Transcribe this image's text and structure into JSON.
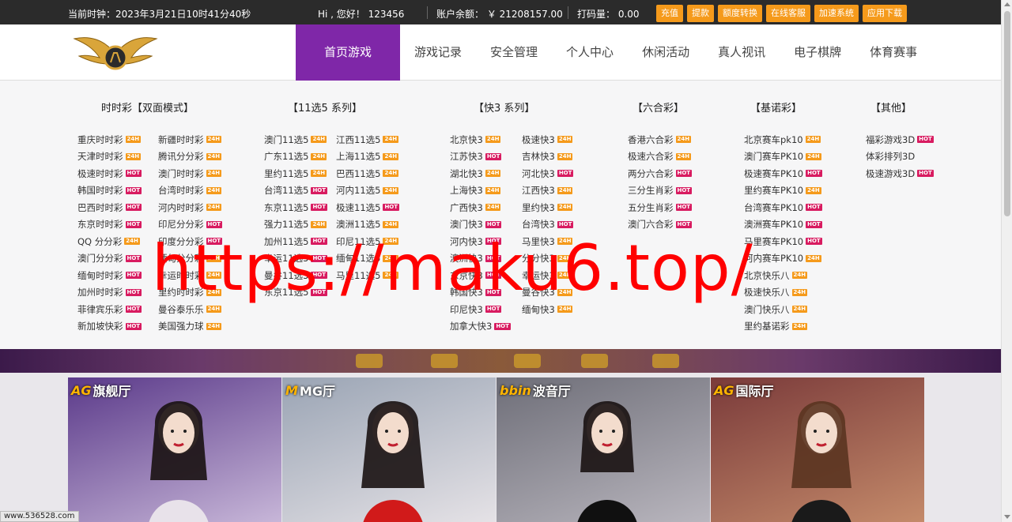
{
  "topbar": {
    "clock": "当前时钟：2023年3月21日10时41分40秒",
    "greeting": "Hi , 您好！ 123456",
    "balance": "账户余额：  ￥ 21208157.00",
    "bet_amount": "打码量：  0.00",
    "buttons": [
      "充值",
      "提款",
      "额度转换",
      "在线客服",
      "加速系统",
      "应用下载"
    ]
  },
  "nav": {
    "items": [
      "首页游戏",
      "游戏记录",
      "安全管理",
      "个人中心",
      "休闲活动",
      "真人视讯",
      "电子棋牌",
      "体育赛事"
    ],
    "active_index": 0
  },
  "colors": {
    "active_nav": "#7f27a8",
    "button": "#f59a1b",
    "hot_tag": "#d81b60",
    "tag_24h": "#f59a1b",
    "watermark": "#ff0000"
  },
  "tags": {
    "hot": "HOT",
    "h24": "24H"
  },
  "dropdown": {
    "columns": [
      {
        "title": "时时彩【双面模式】",
        "rows": [
          [
            [
              "重庆时时彩",
              "h24"
            ],
            [
              "新疆时时彩",
              "h24"
            ]
          ],
          [
            [
              "天津时时彩",
              "h24"
            ],
            [
              "腾讯分分彩",
              "h24"
            ]
          ],
          [
            [
              "极速时时彩",
              "hot"
            ],
            [
              "澳门时时彩",
              "h24"
            ]
          ],
          [
            [
              "韩国时时彩",
              "hot"
            ],
            [
              "台湾时时彩",
              "h24"
            ]
          ],
          [
            [
              "巴西时时彩",
              "hot"
            ],
            [
              "河内时时彩",
              "h24"
            ]
          ],
          [
            [
              "东京时时彩",
              "hot"
            ],
            [
              "印尼分分彩",
              "hot"
            ]
          ],
          [
            [
              "QQ 分分彩",
              "h24"
            ],
            [
              "印度分分彩",
              "hot"
            ]
          ],
          [
            [
              "澳门分分彩",
              "hot"
            ],
            [
              "缅甸分分彩",
              "h24"
            ]
          ],
          [
            [
              "缅甸时时彩",
              "hot"
            ],
            [
              "幸运时时彩",
              "h24"
            ]
          ],
          [
            [
              "加州时时彩",
              "hot"
            ],
            [
              "里约时时彩",
              "h24"
            ]
          ],
          [
            [
              "菲律宾乐彩",
              "hot"
            ],
            [
              "曼谷泰乐乐",
              "h24"
            ]
          ],
          [
            [
              "新加坡快彩",
              "hot"
            ],
            [
              "美国强力球",
              "h24"
            ]
          ]
        ]
      },
      {
        "title": "【11选5 系列】",
        "rows": [
          [
            [
              "澳门11选5",
              "h24"
            ],
            [
              "江西11选5",
              "h24"
            ]
          ],
          [
            [
              "广东11选5",
              "h24"
            ],
            [
              "上海11选5",
              "h24"
            ]
          ],
          [
            [
              "里约11选5",
              "h24"
            ],
            [
              "巴西11选5",
              "h24"
            ]
          ],
          [
            [
              "台湾11选5",
              "hot"
            ],
            [
              "河内11选5",
              "h24"
            ]
          ],
          [
            [
              "东京11选5",
              "hot"
            ],
            [
              "极速11选5",
              "hot"
            ]
          ],
          [
            [
              "强力11选5",
              "h24"
            ],
            [
              "澳洲11选5",
              "h24"
            ]
          ],
          [
            [
              "加州11选5",
              "hot"
            ],
            [
              "印尼11选5",
              "h24"
            ]
          ],
          [
            [
              "幸运11选5",
              "hot"
            ],
            [
              "缅甸11选5",
              "h24"
            ]
          ],
          [
            [
              "曼谷11选5",
              "hot"
            ],
            [
              "马里11选5",
              "h24"
            ]
          ],
          [
            [
              "东京11选5",
              "hot"
            ]
          ]
        ]
      },
      {
        "title": "【快3 系列】",
        "rows": [
          [
            [
              "北京快3",
              "h24"
            ],
            [
              "极速快3",
              "h24"
            ]
          ],
          [
            [
              "江苏快3",
              "hot"
            ],
            [
              "吉林快3",
              "h24"
            ]
          ],
          [
            [
              "湖北快3",
              "h24"
            ],
            [
              "河北快3",
              "hot"
            ]
          ],
          [
            [
              "上海快3",
              "h24"
            ],
            [
              "江西快3",
              "h24"
            ]
          ],
          [
            [
              "广西快3",
              "h24"
            ],
            [
              "里约快3",
              "h24"
            ]
          ],
          [
            [
              "澳门快3",
              "hot"
            ],
            [
              "台湾快3",
              "hot"
            ]
          ],
          [
            [
              "河内快3",
              "hot"
            ],
            [
              "马里快3",
              "h24"
            ]
          ],
          [
            [
              "澳洲快3",
              "hot"
            ],
            [
              "分分快3",
              "h24"
            ]
          ],
          [
            [
              "东京快3",
              "hot"
            ],
            [
              "幸运快3",
              "h24"
            ]
          ],
          [
            [
              "韩国快3",
              "hot"
            ],
            [
              "曼谷快3",
              "h24"
            ]
          ],
          [
            [
              "印尼快3",
              "hot"
            ],
            [
              "缅甸快3",
              "h24"
            ]
          ],
          [
            [
              "加拿大快3",
              "hot"
            ]
          ]
        ]
      },
      {
        "title": "【六合彩】",
        "rows": [
          [
            [
              "香港六合彩",
              "h24"
            ]
          ],
          [
            [
              "极速六合彩",
              "h24"
            ]
          ],
          [
            [
              "两分六合彩",
              "hot"
            ]
          ],
          [
            [
              "三分生肖彩",
              "hot"
            ]
          ],
          [
            [
              "五分生肖彩",
              "hot"
            ]
          ],
          [
            [
              "澳门六合彩",
              "hot"
            ]
          ]
        ]
      },
      {
        "title": "【基诺彩】",
        "rows": [
          [
            [
              "北京赛车pk10",
              "h24"
            ]
          ],
          [
            [
              "澳门赛车PK10",
              "h24"
            ]
          ],
          [
            [
              "极速赛车PK10",
              "hot"
            ]
          ],
          [
            [
              "里约赛车PK10",
              "h24"
            ]
          ],
          [
            [
              "台湾赛车PK10",
              "hot"
            ]
          ],
          [
            [
              "澳洲赛车PK10",
              "hot"
            ]
          ],
          [
            [
              "马里赛车PK10",
              "hot"
            ]
          ],
          [
            [
              "河内赛车PK10",
              "h24"
            ]
          ],
          [
            [
              "北京快乐八",
              "h24"
            ]
          ],
          [
            [
              "极速快乐八",
              "h24"
            ]
          ],
          [
            [
              "澳门快乐八",
              "h24"
            ]
          ],
          [
            [
              "里约基诺彩",
              "h24"
            ]
          ]
        ]
      },
      {
        "title": "【其他】",
        "rows": [
          [
            [
              "福彩游戏3D",
              "hot"
            ]
          ],
          [
            [
              "体彩排列3D",
              ""
            ]
          ],
          [
            [
              "极速游戏3D",
              "hot"
            ]
          ]
        ]
      }
    ]
  },
  "cards": [
    {
      "prefix": "AG",
      "title": "旗舰厅",
      "bg1": "#5b3a8a",
      "bg2": "#c7b6d8"
    },
    {
      "prefix": "M",
      "title": "MG厅",
      "bg1": "#9aa4b4",
      "bg2": "#e5e2e6"
    },
    {
      "prefix": "bbin",
      "title": "波音厅",
      "bg1": "#6e6e78",
      "bg2": "#b9b6be"
    },
    {
      "prefix": "AG",
      "title": "国际厅",
      "bg1": "#7a3a3a",
      "bg2": "#c48a6a"
    }
  ],
  "watermark": "https://maku6.top/",
  "status_url": "www.536528.com"
}
